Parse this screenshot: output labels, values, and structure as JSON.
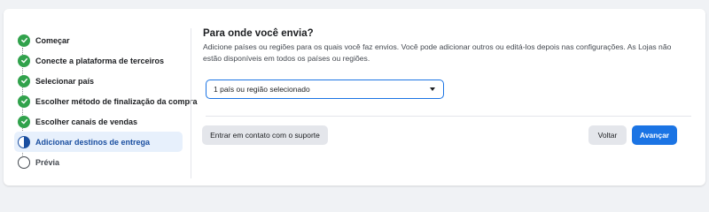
{
  "steps": [
    {
      "label": "Começar",
      "state": "done"
    },
    {
      "label": "Conecte a plataforma de terceiros",
      "state": "done"
    },
    {
      "label": "Selecionar país",
      "state": "done"
    },
    {
      "label": "Escolher método de finalização da compra",
      "state": "done"
    },
    {
      "label": "Escolher canais de vendas",
      "state": "done"
    },
    {
      "label": "Adicionar destinos de entrega",
      "state": "active"
    },
    {
      "label": "Prévia",
      "state": "pending"
    }
  ],
  "main": {
    "title": "Para onde você envia?",
    "description": "Adicione países ou regiões para os quais você faz envios. Você pode adicionar outros ou editá-los depois nas configurações. As Lojas não estão disponíveis em todos os países ou regiões.",
    "dropdown_value": "1 país ou região selecionado"
  },
  "footer": {
    "support_label": "Entrar em contato com o suporte",
    "back_label": "Voltar",
    "next_label": "Avançar"
  },
  "colors": {
    "accent": "#1b74e4",
    "done": "#31a24c",
    "active_text": "#1b4fa0",
    "active_bg": "#e7f0fc"
  }
}
